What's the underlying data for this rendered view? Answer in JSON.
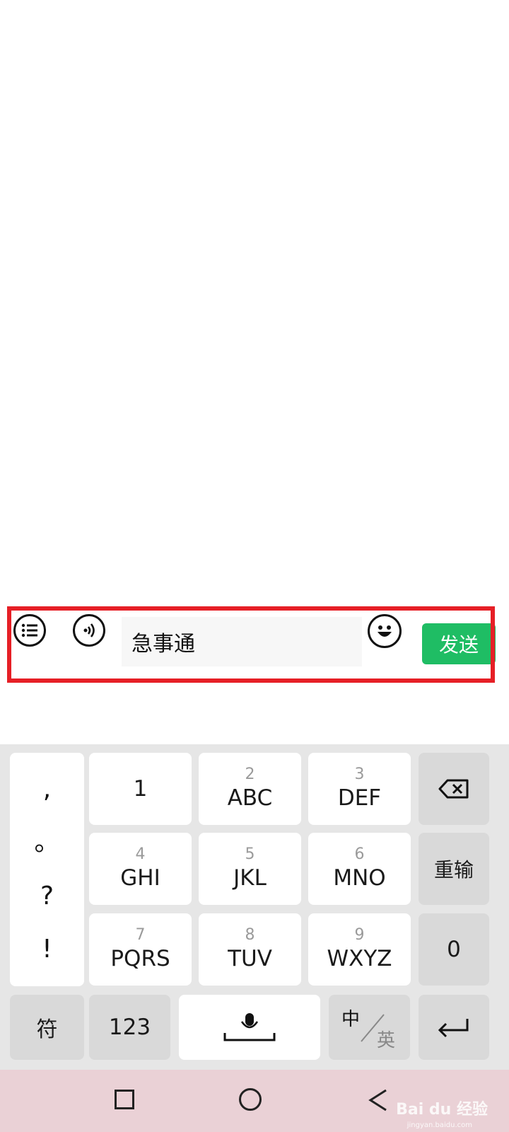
{
  "input_bar": {
    "text_value": "急事通",
    "send_label": "发送"
  },
  "keyboard": {
    "punctuation": [
      ",",
      "。",
      "?",
      "!"
    ],
    "row1": [
      {
        "num": "",
        "letters": "1"
      },
      {
        "num": "2",
        "letters": "ABC"
      },
      {
        "num": "3",
        "letters": "DEF"
      }
    ],
    "row2": [
      {
        "num": "4",
        "letters": "GHI"
      },
      {
        "num": "5",
        "letters": "JKL"
      },
      {
        "num": "6",
        "letters": "MNO"
      }
    ],
    "row3": [
      {
        "num": "7",
        "letters": "PQRS"
      },
      {
        "num": "8",
        "letters": "TUV"
      },
      {
        "num": "9",
        "letters": "WXYZ"
      }
    ],
    "reenter_label": "重输",
    "zero_label": "0",
    "symbols_label": "符",
    "numeric_label": "123",
    "lang_cn": "中",
    "lang_en": "英"
  },
  "watermark": {
    "brand": "Bai du 经验",
    "url": "jingyan.baidu.com"
  },
  "colors": {
    "send_green": "#1fbd64",
    "highlight_red": "#e61f26",
    "nav_pink": "#ead1d6"
  }
}
